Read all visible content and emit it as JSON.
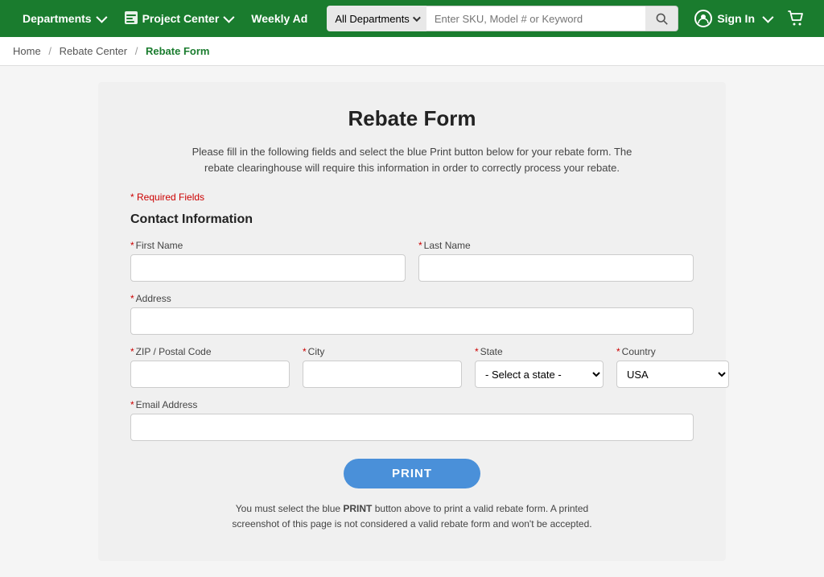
{
  "header": {
    "departments_label": "Departments",
    "project_center_label": "Project Center",
    "weekly_ad_label": "Weekly Ad",
    "search": {
      "dept_label": "All Departments",
      "placeholder": "Enter SKU, Model # or Keyword"
    },
    "signin_label": "Sign In",
    "cart_label": "Cart"
  },
  "breadcrumb": {
    "home": "Home",
    "rebate_center": "Rebate Center",
    "current": "Rebate Form"
  },
  "form": {
    "title": "Rebate Form",
    "description": "Please fill in the following fields and select the blue Print button below for your rebate form. The rebate clearinghouse will require this information in order to correctly process your rebate.",
    "required_note": "* Required Fields",
    "section_title": "Contact Information",
    "fields": {
      "first_name_label": "First Name",
      "last_name_label": "Last Name",
      "address_label": "Address",
      "zip_label": "ZIP / Postal Code",
      "city_label": "City",
      "state_label": "State",
      "country_label": "Country",
      "email_label": "Email Address"
    },
    "state_default": "- Select a state -",
    "country_default": "USA",
    "print_button": "PRINT",
    "print_note": "You must select the blue PRINT button above to print a valid rebate form. A printed screenshot of this page is not considered a valid rebate form and won't be accepted."
  }
}
